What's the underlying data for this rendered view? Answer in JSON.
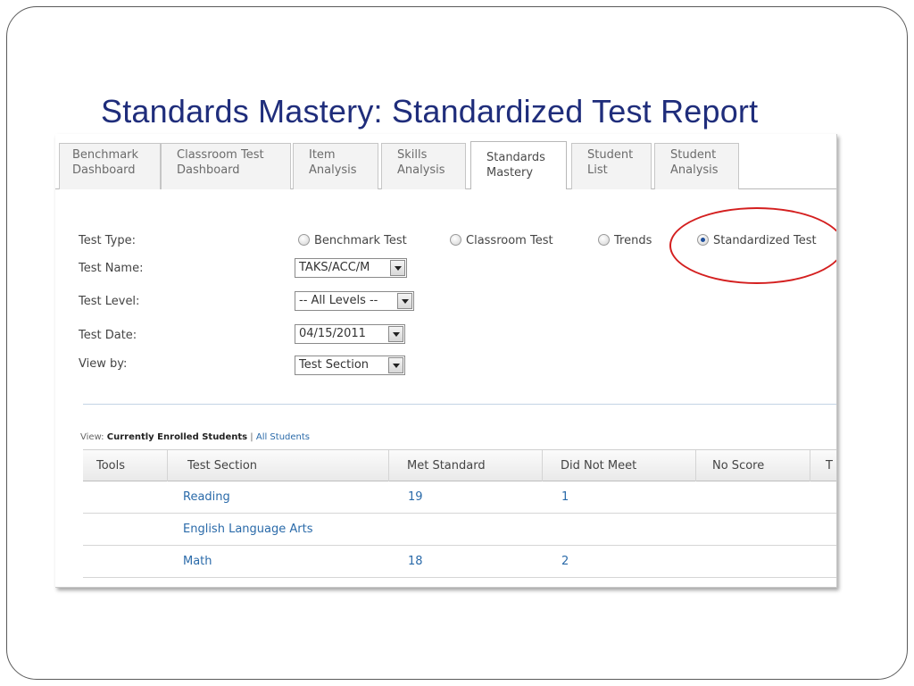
{
  "slide": {
    "title": "Standards Mastery: Standardized Test Report"
  },
  "tabs": [
    {
      "line1": "Benchmark",
      "line2": "Dashboard"
    },
    {
      "line1": "Classroom Test",
      "line2": "Dashboard"
    },
    {
      "line1": "Item",
      "line2": "Analysis"
    },
    {
      "line1": "Skills",
      "line2": "Analysis"
    },
    {
      "line1": "Standards",
      "line2": "Mastery",
      "active": true
    },
    {
      "line1": "Student",
      "line2": "List"
    },
    {
      "line1": "Student",
      "line2": "Analysis"
    }
  ],
  "form": {
    "test_type_label": "Test Type:",
    "test_type_options": [
      {
        "label": "Benchmark Test",
        "selected": false
      },
      {
        "label": "Classroom Test",
        "selected": false
      },
      {
        "label": "Trends",
        "selected": false
      },
      {
        "label": "Standardized Test",
        "selected": true
      }
    ],
    "test_name_label": "Test Name:",
    "test_name_value": "TAKS/ACC/M",
    "test_level_label": "Test Level:",
    "test_level_value": "-- All Levels --",
    "test_date_label": "Test Date:",
    "test_date_value": "04/15/2011",
    "view_by_label": "View by:",
    "view_by_value": "Test Section"
  },
  "view_filter": {
    "prefix": "View:",
    "current": "Currently Enrolled Students",
    "divider": "|",
    "all": "All Students"
  },
  "table": {
    "headers": [
      "Tools",
      "Test Section",
      "Met Standard",
      "Did Not Meet",
      "No Score",
      "T"
    ],
    "rows": [
      {
        "section": "Reading",
        "met": "19",
        "not_met": "1"
      },
      {
        "section": "English Language Arts",
        "met": "",
        "not_met": ""
      },
      {
        "section": "Math",
        "met": "18",
        "not_met": "2"
      }
    ]
  },
  "colors": {
    "title": "#1f2d7b",
    "link": "#2a6aa9",
    "highlight": "#d41f1f"
  }
}
